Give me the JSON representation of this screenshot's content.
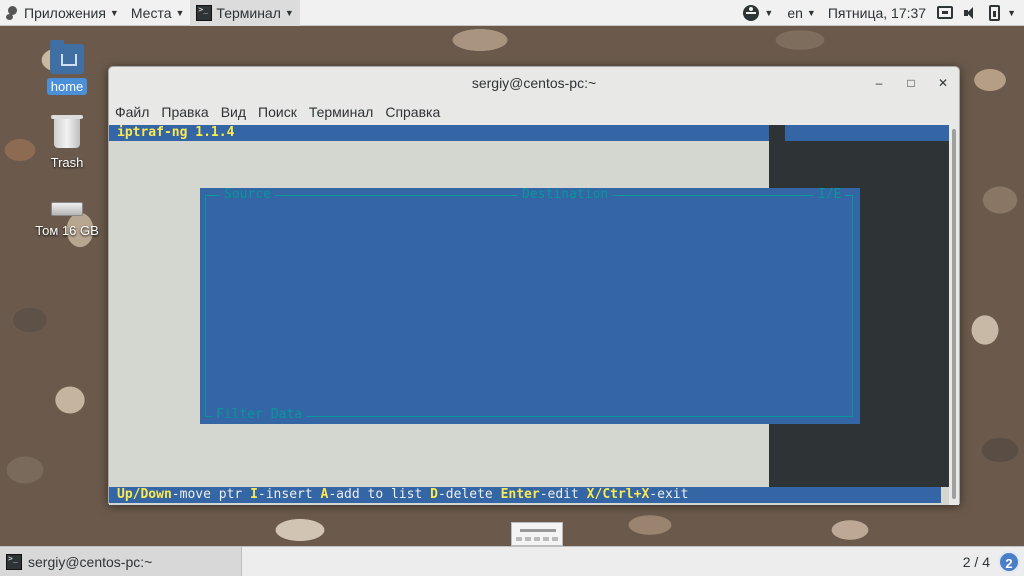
{
  "topbar": {
    "applications": "Приложения",
    "places": "Места",
    "active_app": "Терминал",
    "active_app_icon_text": ">_",
    "language": "en",
    "datetime": "Пятница, 17:37"
  },
  "desktop": {
    "icons": [
      {
        "label": "home",
        "icon": "folder-icon"
      },
      {
        "label": "Trash",
        "icon": "trash-icon"
      },
      {
        "label": "Том 16 GB",
        "icon": "drive-icon"
      }
    ]
  },
  "window": {
    "title": "sergiy@centos-pc:~",
    "controls": {
      "minimize": "–",
      "maximize": "□",
      "close": "✕"
    },
    "menu": [
      "Файл",
      "Правка",
      "Вид",
      "Поиск",
      "Терминал",
      "Справка"
    ]
  },
  "terminal": {
    "header": "iptraf-ng 1.1.4",
    "dialog": {
      "source": "Source",
      "destination": "Destination",
      "ie": "I/E",
      "filter_data": "Filter Data"
    },
    "status": [
      {
        "key": "Up/Down",
        "desc": "-move ptr "
      },
      {
        "key": "I",
        "desc": "-insert "
      },
      {
        "key": "A",
        "desc": "-add to list "
      },
      {
        "key": "D",
        "desc": "-delete "
      },
      {
        "key": "Enter",
        "desc": "-edit "
      },
      {
        "key": "X/Ctrl+X",
        "desc": "-exit"
      }
    ]
  },
  "bottombar": {
    "task_label": "sergiy@centos-pc:~",
    "workspace_text": "2 / 4",
    "workspace_badge": "2"
  }
}
